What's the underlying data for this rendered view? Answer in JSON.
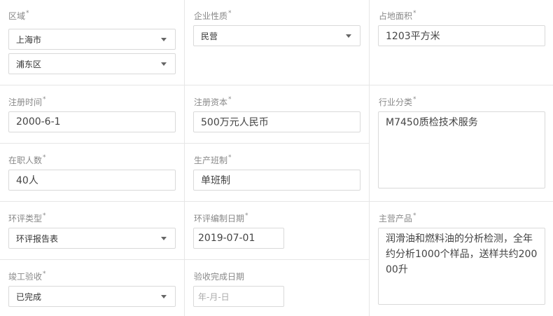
{
  "region": {
    "label": "区域",
    "required_mark": "*",
    "city": "上海市",
    "district": "浦东区"
  },
  "enterprise_nature": {
    "label": "企业性质",
    "required_mark": "*",
    "value": "民营"
  },
  "land_area": {
    "label": "占地面积",
    "required_mark": "*",
    "value": "1203平方米"
  },
  "registration_date": {
    "label": "注册时间",
    "required_mark": "*",
    "value": "2000-6-1"
  },
  "registered_capital": {
    "label": "注册资本",
    "required_mark": "*",
    "value": "500万元人民币"
  },
  "industry": {
    "label": "行业分类",
    "required_mark": "*",
    "value": "M7450质检技术服务"
  },
  "employees": {
    "label": "在职人数",
    "required_mark": "*",
    "value": "40人"
  },
  "shift": {
    "label": "生产班制",
    "required_mark": "*",
    "value": "单班制"
  },
  "eia_type": {
    "label": "环评类型",
    "required_mark": "*",
    "value": "环评报告表"
  },
  "eia_date": {
    "label": "环评编制日期",
    "required_mark": "*",
    "value": "2019-07-01"
  },
  "main_products": {
    "label": "主营产品",
    "required_mark": "*",
    "value": "润滑油和燃料油的分析检测，全年约分析1000个样品，送样共约20000升"
  },
  "acceptance": {
    "label": "竣工验收",
    "required_mark": "*",
    "value": "已完成"
  },
  "acceptance_date": {
    "label": "验收完成日期",
    "placeholder": "年-月-日"
  }
}
